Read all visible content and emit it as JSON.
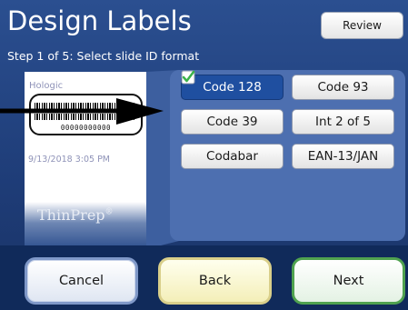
{
  "header": {
    "title": "Design Labels",
    "review_label": "Review"
  },
  "step": {
    "text": "Step 1 of 5: Select slide ID format"
  },
  "slide_preview": {
    "vendor": "Hologic",
    "barcode_number": "00000000000",
    "date": "9/13/2018 3:05 PM",
    "brand": "ThinPrep",
    "brand_mark": "®"
  },
  "formats": [
    {
      "label": "Code 128",
      "selected": true
    },
    {
      "label": "Code 93",
      "selected": false
    },
    {
      "label": "Code 39",
      "selected": false
    },
    {
      "label": "Int 2 of 5",
      "selected": false
    },
    {
      "label": "Codabar",
      "selected": false
    },
    {
      "label": "EAN-13/JAN",
      "selected": false
    }
  ],
  "footer": {
    "cancel_label": "Cancel",
    "back_label": "Back",
    "next_label": "Next"
  },
  "colors": {
    "background": "#1e3c77",
    "panel": "#4d6fb0",
    "selected": "#1f4fa0",
    "check": "#3bb34a",
    "next_border": "#4fa24f",
    "back_border": "#d9cf8a"
  }
}
